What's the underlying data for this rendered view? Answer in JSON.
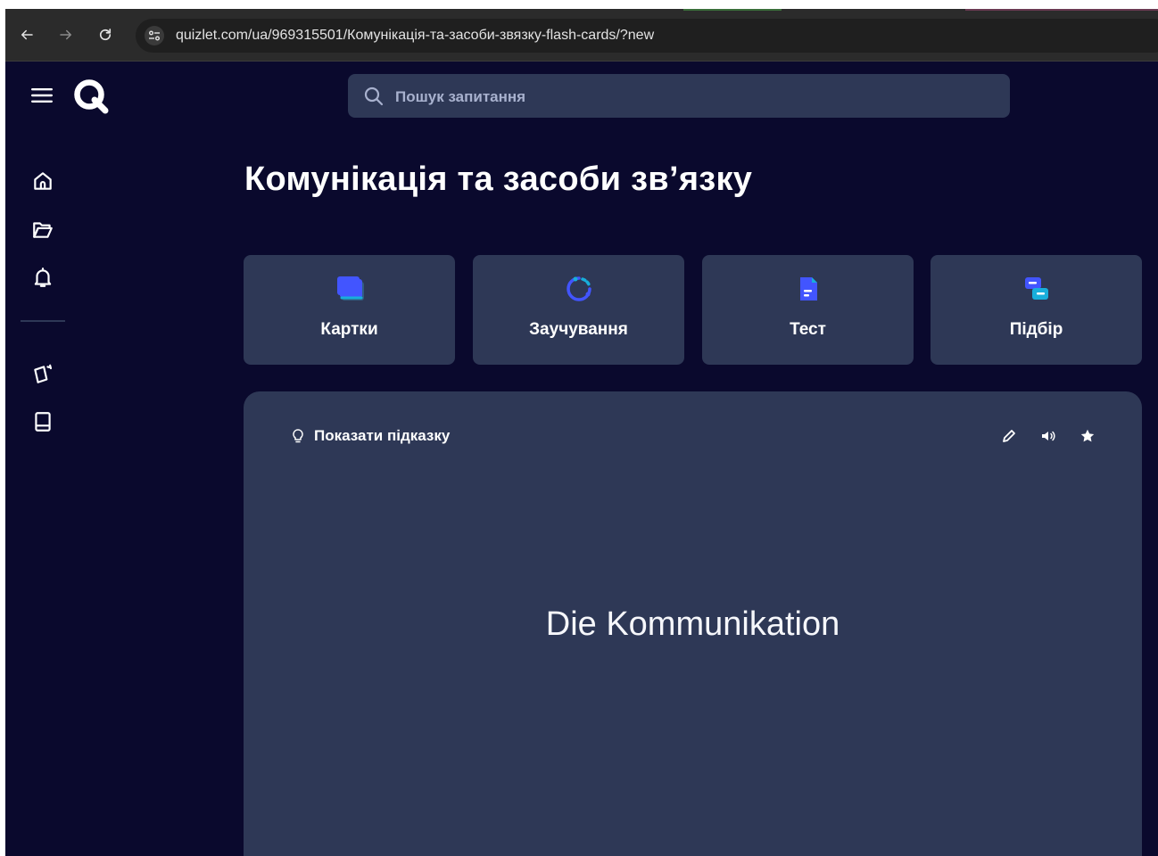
{
  "browser": {
    "url": "quizlet.com/ua/969315501/Комунікація-та-засоби-звязку-flash-cards/?new",
    "back_icon": "arrow-left-icon",
    "forward_icon": "arrow-right-icon",
    "reload_icon": "reload-icon",
    "site_info_icon": "tune-icon"
  },
  "header": {
    "menu_icon": "hamburger-icon",
    "logo_icon": "quizlet-q-logo",
    "search_placeholder": "Пошук запитання"
  },
  "sidebar": {
    "items": [
      {
        "icon": "home-icon"
      },
      {
        "icon": "folder-icon"
      },
      {
        "icon": "bell-icon"
      },
      {
        "icon": "flashcards-icon"
      },
      {
        "icon": "book-icon"
      }
    ]
  },
  "main": {
    "title": "Комунікація та засоби зв’язку",
    "modes": [
      {
        "label": "Картки",
        "icon": "cards-mode-icon"
      },
      {
        "label": "Заучування",
        "icon": "learn-mode-icon"
      },
      {
        "label": "Тест",
        "icon": "test-mode-icon"
      },
      {
        "label": "Підбір",
        "icon": "match-mode-icon"
      }
    ],
    "flashcard": {
      "hint_label": "Показати підказку",
      "term": "Die Kommunikation",
      "actions": [
        "edit-icon",
        "audio-icon",
        "star-icon"
      ]
    }
  },
  "colors": {
    "page_bg": "#0a092d",
    "surface": "#2e3856",
    "accent_blue": "#4255ff",
    "accent_cyan": "#18aedb",
    "text": "#ffffff",
    "muted_text": "#a8b1ce"
  }
}
